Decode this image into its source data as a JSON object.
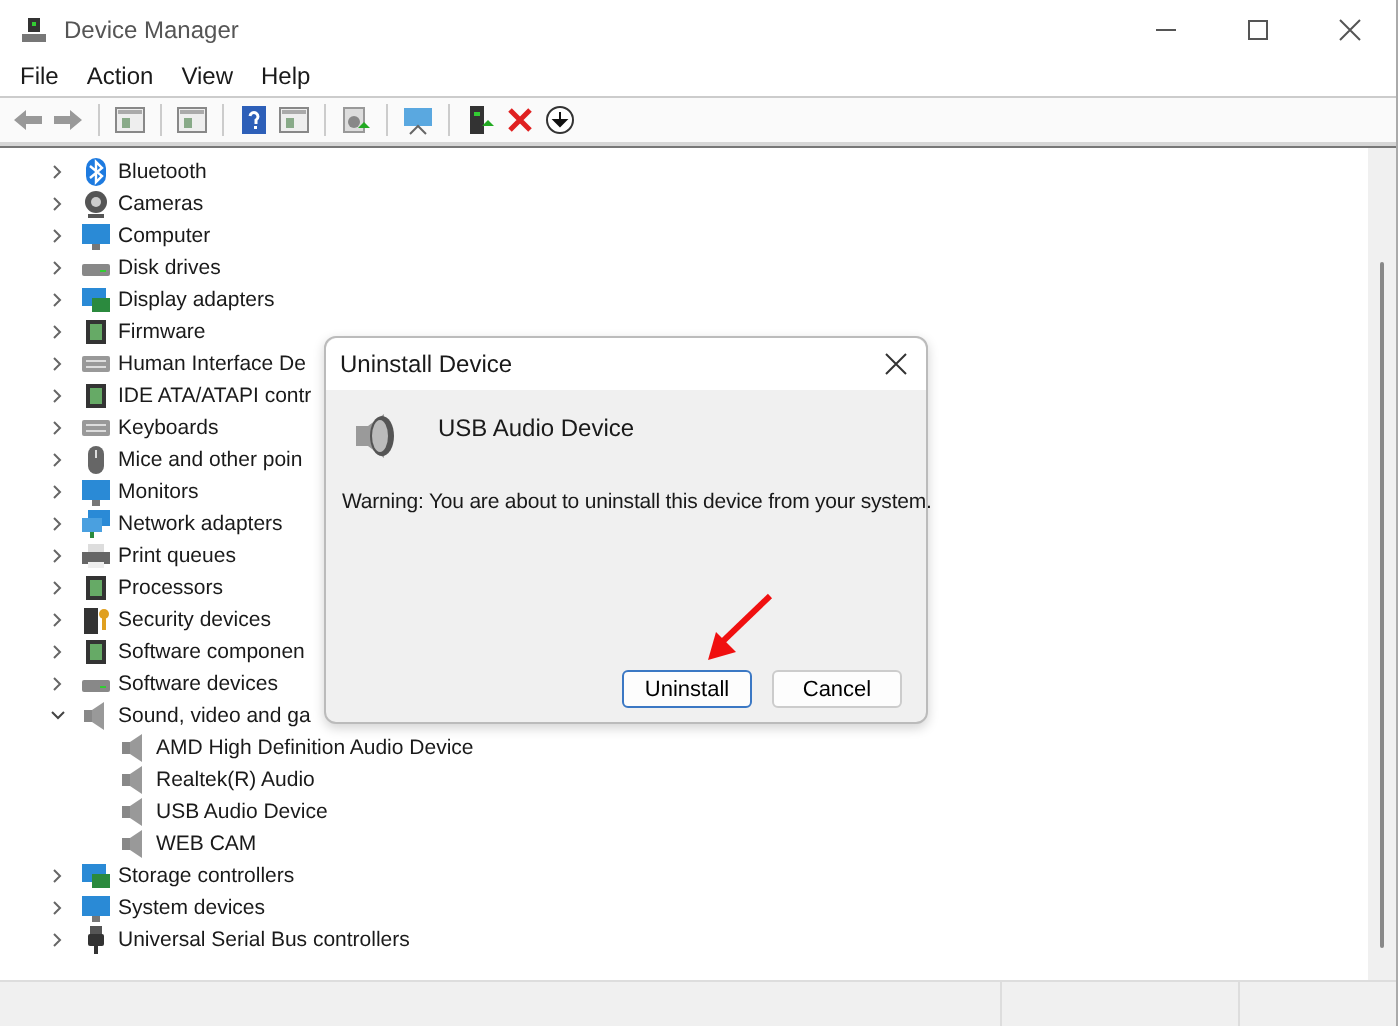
{
  "window": {
    "title": "Device Manager"
  },
  "menu": [
    "File",
    "Action",
    "View",
    "Help"
  ],
  "tree": [
    {
      "label": "Bluetooth",
      "expanded": false
    },
    {
      "label": "Cameras",
      "expanded": false
    },
    {
      "label": "Computer",
      "expanded": false
    },
    {
      "label": "Disk drives",
      "expanded": false
    },
    {
      "label": "Display adapters",
      "expanded": false
    },
    {
      "label": "Firmware",
      "expanded": false
    },
    {
      "label": "Human Interface De",
      "expanded": false
    },
    {
      "label": "IDE ATA/ATAPI contr",
      "expanded": false
    },
    {
      "label": "Keyboards",
      "expanded": false
    },
    {
      "label": "Mice and other poin",
      "expanded": false
    },
    {
      "label": "Monitors",
      "expanded": false
    },
    {
      "label": "Network adapters",
      "expanded": false
    },
    {
      "label": "Print queues",
      "expanded": false
    },
    {
      "label": "Processors",
      "expanded": false
    },
    {
      "label": "Security devices",
      "expanded": false
    },
    {
      "label": "Software componen",
      "expanded": false
    },
    {
      "label": "Software devices",
      "expanded": false
    },
    {
      "label": "Sound, video and ga",
      "expanded": true,
      "children": [
        {
          "label": "AMD High Definition Audio Device"
        },
        {
          "label": "Realtek(R) Audio"
        },
        {
          "label": "USB Audio Device"
        },
        {
          "label": "WEB CAM"
        }
      ]
    },
    {
      "label": "Storage controllers",
      "expanded": false
    },
    {
      "label": "System devices",
      "expanded": false
    },
    {
      "label": "Universal Serial Bus controllers",
      "expanded": false
    }
  ],
  "dialog": {
    "title": "Uninstall Device",
    "device": "USB Audio Device",
    "warning": "Warning: You are about to uninstall this device from your system.",
    "buttons": [
      {
        "label": "Uninstall",
        "default": true
      },
      {
        "label": "Cancel",
        "default": false
      }
    ]
  }
}
